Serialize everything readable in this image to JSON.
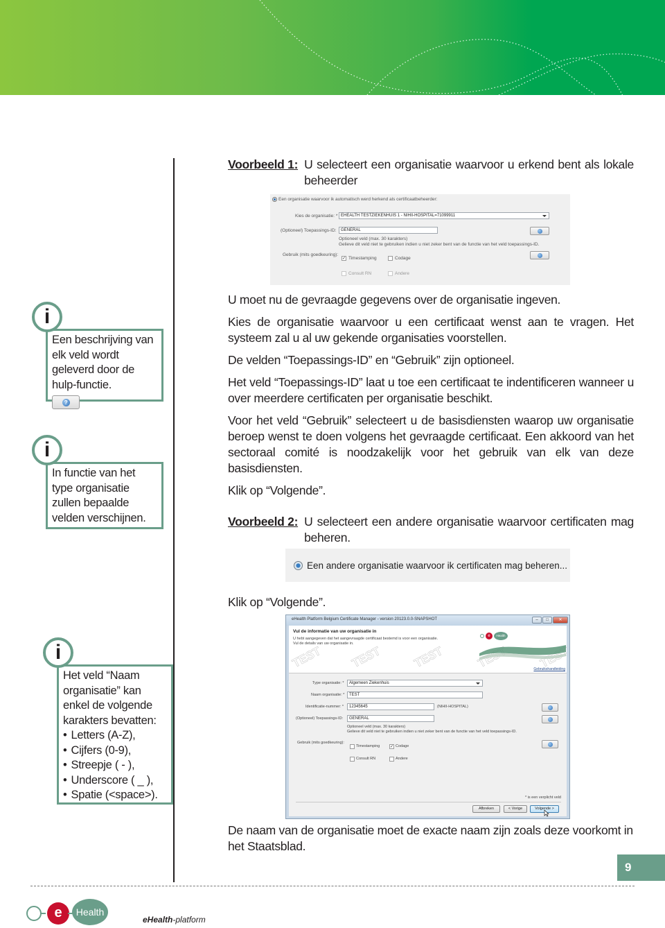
{
  "page": {
    "number": "9",
    "colors": {
      "accent": "#6a9e8a",
      "header_green_start": "#8cc63f",
      "header_green_end": "#00a651",
      "logo_red": "#c8102e"
    }
  },
  "example1": {
    "label": "Voorbeeld 1:",
    "text": "U selecteert een organisatie waarvoor u erkend bent als lokale beheerder"
  },
  "screenshot1": {
    "radio_label": "Een organisatie waarvoor ik automatisch werd herkend als certificaatbeheerder:",
    "org_label": "Kies de organisatie: *",
    "org_value": "EHEALTH TESTZIEKENHUIS 1 - NIHII-HOSPITAL=71099911",
    "app_id_label": "(Optioneel) Toepassings-ID:",
    "app_id_value": "GENERAL",
    "hint_line1": "Optioneel veld (max. 30 karakters)",
    "hint_line2": "Gelieve dit veld niet te gebruiken indien u niet zeker bent van de functie van het veld toepassings-ID.",
    "usage_label": "Gebruik (mits goedkeuring):",
    "checkboxes": [
      {
        "label": "Timestamping",
        "checked": true,
        "check_glyph": "✓"
      },
      {
        "label": "Codage",
        "checked": false
      },
      {
        "label": "Consult RN",
        "checked": false
      },
      {
        "label": "Andere",
        "checked": false
      }
    ]
  },
  "main_text": {
    "p1": "U moet nu de gevraagde gegevens over de organisatie ingeven.",
    "p2": "Kies de organisatie waarvoor u een certificaat wenst aan te vragen. Het systeem zal u al uw gekende organisaties voorstellen.",
    "p3": "De velden “Toepassings-ID” en “Gebruik” zijn optioneel.",
    "p4": "Het veld “Toepassings-ID” laat u toe een certificaat te indentificeren wanneer u over meerdere certificaten per organisatie beschikt.",
    "p5": "Voor het veld “Gebruik” selecteert u de basisdiensten waarop uw organisatie beroep wenst te doen volgens het gevraagde certificaat. Een akkoord van het sectoraal comité is noodzakelijk voor het gebruik van elk van deze basisdiensten.",
    "p6": "Klik op “Volgende”.",
    "p7": "Klik op “Volgende”.",
    "p8": "De naam van de organisatie moet de exacte naam zijn zoals deze voorkomt in het Staatsblad."
  },
  "example2": {
    "label": "Voorbeeld 2:",
    "text": "U selecteert een andere organisatie waarvoor certificaten mag beheren."
  },
  "screenshot2": {
    "radio_label": "Een andere organisatie waarvoor ik certificaten mag beheren..."
  },
  "screenshot3": {
    "window_title": "eHealth Platform Belgium Certificate Manager - version 20123.0.0-SNAPSHOT",
    "heading": "Vul de informatie van uw organisatie in",
    "sub1": "U hebt aangegeven dat het aangevraagde certificaat bestemd is voor een organisatie.",
    "sub2": "Vul de details van uw organisatie in.",
    "watermark": "TEST",
    "help_link": "Gebruikshandleiding",
    "logo_e": "e",
    "logo_health": "Health",
    "type_label": "Type organisatie: *",
    "type_value": "Algemeen Ziekenhuis",
    "name_label": "Naam organisatie: *",
    "name_value": "TEST",
    "id_label": "Identificatie-nummer: *",
    "id_value": "12345645",
    "id_suffix": "(NIHII-HOSPITAL)",
    "app_id_label": "(Optioneel) Toepassings-ID:",
    "app_id_value": "GENERAL",
    "hint_line1": "Optioneel veld (max. 30 karakters)",
    "hint_line2": "Gelieve dit veld niet te gebruiken indien u niet zeker bent van de functie van het veld toepassings-ID.",
    "usage_label": "Gebruik (mits goedkeuring):",
    "checkboxes": [
      {
        "label": "Timestamping",
        "checked": false
      },
      {
        "label": "Codage",
        "checked": true,
        "check_glyph": "✓"
      },
      {
        "label": "Consult RN",
        "checked": false
      },
      {
        "label": "Andere",
        "checked": false
      }
    ],
    "required_note": "* is een verplicht veld",
    "buttons": {
      "cancel": "Afbreken",
      "previous": "< Vorige",
      "next": "Volgende >"
    }
  },
  "info_boxes": {
    "icon_glyph": "i",
    "help_glyph": "?",
    "box1": "Een beschrijving van elk veld wordt geleverd door de hulp-functie.",
    "box2": "In functie van het type organisatie zullen bepaalde velden verschijnen.",
    "box3_intro": "Het veld “Naam organisatie” kan enkel de volgende karakters bevatten:",
    "box3_items": [
      "Letters (A-Z),",
      "Cijfers (0-9),",
      "Streepje ( - ),",
      "Underscore ( _ ),",
      "Spatie (<space>)."
    ]
  },
  "footer": {
    "logo_e": "e",
    "logo_health": "Health",
    "brand_bold": "eHealth",
    "brand_rest": "-platform"
  }
}
